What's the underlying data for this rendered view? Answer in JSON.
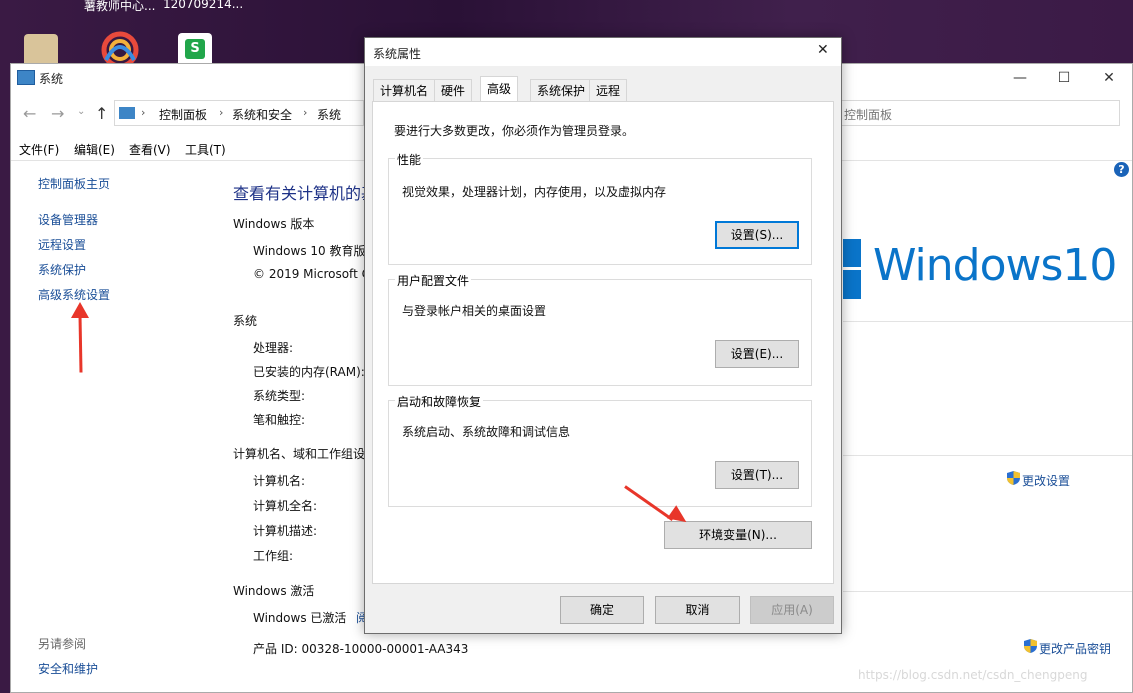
{
  "desktop": {
    "top_label_1": "薯教师中心...",
    "top_label_2": "120709214..."
  },
  "system_window": {
    "title": "系统",
    "breadcrumb": [
      "控制面板",
      "系统和安全",
      "系统"
    ],
    "search_placeholder": "控制面板",
    "menu": [
      "文件(F)",
      "编辑(E)",
      "查看(V)",
      "工具(T)"
    ],
    "sidebar": {
      "home": "控制面板主页",
      "items": [
        "设备管理器",
        "远程设置",
        "系统保护",
        "高级系统设置"
      ],
      "see_also": "另请参阅",
      "see_also_items": [
        "安全和维护"
      ]
    },
    "heading": "查看有关计算机的基",
    "edition": {
      "section": "Windows 版本",
      "name": "Windows 10 教育版",
      "copyright": "© 2019 Microsoft C"
    },
    "system": {
      "section": "系统",
      "rows": [
        "处理器:",
        "已安装的内存(RAM):",
        "系统类型:",
        "笔和触控:"
      ]
    },
    "computer": {
      "section": "计算机名、域和工作组设",
      "rows": [
        "计算机名:",
        "计算机全名:",
        "计算机描述:",
        "工作组:"
      ],
      "change_link": "更改设置"
    },
    "activation": {
      "section": "Windows 激活",
      "status": "Windows 已激活",
      "status_link": "阅",
      "product_id": "产品 ID: 00328-10000-00001-AA343",
      "change_key_link": "更改产品密钥"
    },
    "logo_text": "Windows10"
  },
  "dialog": {
    "title": "系统属性",
    "close": "✕",
    "tabs": [
      "计算机名",
      "硬件",
      "高级",
      "系统保护",
      "远程"
    ],
    "active_tab": "高级",
    "admin_note": "要进行大多数更改，你必须作为管理员登录。",
    "performance": {
      "label": "性能",
      "desc": "视觉效果，处理器计划，内存使用，以及虚拟内存",
      "button": "设置(S)..."
    },
    "profiles": {
      "label": "用户配置文件",
      "desc": "与登录帐户相关的桌面设置",
      "button": "设置(E)..."
    },
    "startup": {
      "label": "启动和故障恢复",
      "desc": "系统启动、系统故障和调试信息",
      "button": "设置(T)..."
    },
    "env_button": "环境变量(N)...",
    "ok": "确定",
    "cancel": "取消",
    "apply": "应用(A)"
  },
  "watermark": "https://blog.csdn.net/csdn_chengpeng",
  "colors": {
    "link": "#1a4e97",
    "accent": "#0078d7",
    "windows_logo": "#0a74c9",
    "arrow": "#e8362a"
  }
}
